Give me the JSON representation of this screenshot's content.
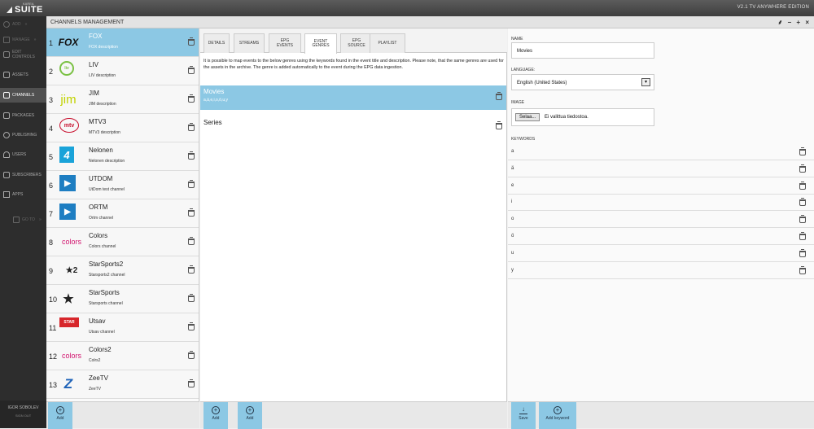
{
  "app": {
    "logo_small": "KAREA",
    "logo_text": "SUITE",
    "version": "V2.1 TV ANYWHERE EDITION"
  },
  "nav": {
    "add": "ADD",
    "manage": "MANAGE",
    "edit_controls": "EDIT CONTROLS",
    "assets": "ASSETS",
    "channels": "CHANNELS",
    "packages": "PACKAGES",
    "publishing": "PUBLISHING",
    "users": "USERS",
    "subscribers": "SUBSCRIBERS",
    "apps": "APPS",
    "goto": "GO TO",
    "user_name": "IGOR SOBOLEV",
    "signout": "SIGN OUT"
  },
  "panel": {
    "title": "CHANNELS MANAGEMENT",
    "win_controls": "⸙ − + ×"
  },
  "channels": [
    {
      "num": "1",
      "name": "FOX",
      "desc": "FOX description",
      "logo": "FOX"
    },
    {
      "num": "2",
      "name": "LIV",
      "desc": "LIV description",
      "logo": "liv"
    },
    {
      "num": "3",
      "name": "JIM",
      "desc": "JIM description",
      "logo": "jim"
    },
    {
      "num": "4",
      "name": "MTV3",
      "desc": "MTV3 description",
      "logo": "mtv"
    },
    {
      "num": "5",
      "name": "Nelonen",
      "desc": "Nelonen description",
      "logo": "4"
    },
    {
      "num": "6",
      "name": "UTDOM",
      "desc": "UtDom test channel",
      "logo": "▶"
    },
    {
      "num": "7",
      "name": "ORTM",
      "desc": "Ortm channel",
      "logo": "▶"
    },
    {
      "num": "8",
      "name": "Colors",
      "desc": "Colors channel",
      "logo": "colors"
    },
    {
      "num": "9",
      "name": "StarSports2",
      "desc": "Starsports2 channel",
      "logo": "★2"
    },
    {
      "num": "10",
      "name": "StarSports",
      "desc": "Starsports channel",
      "logo": "★"
    },
    {
      "num": "11",
      "name": "Utsav",
      "desc": "Utsav channel",
      "logo": "STAR"
    },
    {
      "num": "12",
      "name": "Colors2",
      "desc": "Colrs2",
      "logo": "colors"
    },
    {
      "num": "13",
      "name": "ZeeTV",
      "desc": "ZeeTV",
      "logo": "Z"
    }
  ],
  "tabs": [
    {
      "label": "DETAILS"
    },
    {
      "label": "STREAMS"
    },
    {
      "label": "EPG EVENTS"
    },
    {
      "label": "EVENT GENRES"
    },
    {
      "label": "EPG SOURCE"
    },
    {
      "label": "PLAYLIST"
    }
  ],
  "genres_info": "It is possible to map events to the below genres using the keywords found in the event title and description. Please note, that the same genres are used for the assets in the archive. The genre is added automatically to the event during the EPG data ingestion.",
  "genres": [
    {
      "name": "Movies",
      "keywords": "a,ä,e,i,o,ö,u,y"
    },
    {
      "name": "Series",
      "keywords": ""
    }
  ],
  "details": {
    "name_label": "NAME",
    "name_value": "Movies",
    "language_label": "LANGUAGE:",
    "language_value": "English (United States)",
    "image_label": "IMAGE",
    "browse_button": "Selaa...",
    "file_status": "Ei valittua tiedostoa.",
    "keywords_label": "KEYWORDS",
    "keywords": [
      "a",
      "ä",
      "e",
      "i",
      "o",
      "ö",
      "u",
      "y"
    ]
  },
  "footer": {
    "add": "Add",
    "save": "Save",
    "add_keyword": "Add keyword"
  },
  "colors": {
    "selected": "#8cc8e4",
    "nav_bg": "#2d2d2d",
    "topbar": "#4a4a4a"
  }
}
